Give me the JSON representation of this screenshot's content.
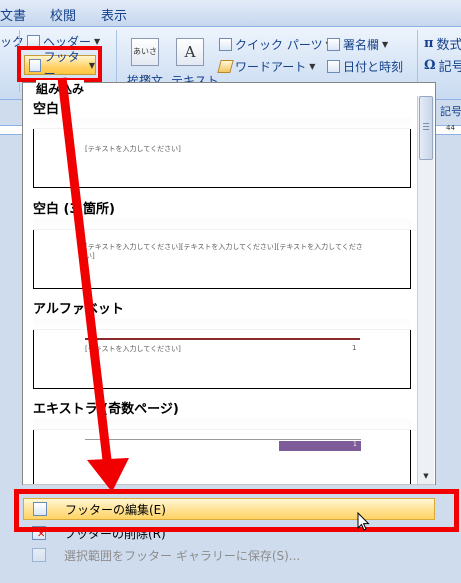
{
  "tabs": [
    {
      "label": "文書"
    },
    {
      "label": "校閲"
    },
    {
      "label": "表示"
    }
  ],
  "ribbon": {
    "left_partial": "ック",
    "header_label": "ヘッダー",
    "footer_label": "フッター",
    "textbox_label": "テキスト",
    "aisatsu_partial": "挨拶文",
    "aisatsu_icon_text": "あいさつ",
    "quick_parts_label": "クイック パーツ",
    "wordart_label": "ワードアート",
    "signature_label": "署名欄",
    "datetime_label": "日付と時刻",
    "equation_partial": "数式",
    "symbol_partial": "記号",
    "symbol_partial2": "記号",
    "ruler_right": "44"
  },
  "gallery": {
    "category_partial": "組み込み",
    "sections": [
      {
        "title": "空白",
        "placeholders": [
          "[テキストを入力してください]"
        ]
      },
      {
        "title": "空白 (3 箇所)",
        "placeholders": [
          "[テキストを入力してください][テキストを入力してください][テキストを入力してくださ",
          "い]"
        ]
      },
      {
        "title": "アルファベット",
        "placeholders": [
          "[テキストを入力してください]",
          "1"
        ]
      },
      {
        "title": "エキストラ (奇数ページ)",
        "placeholders": [
          "1"
        ]
      }
    ]
  },
  "menu": {
    "edit_footer": "フッターの編集(E)",
    "remove_footer": "フッターの削除(R)",
    "save_selection": "選択範囲をフッター ギャラリーに保存(S)..."
  },
  "colors": {
    "highlight_red": "#f00000",
    "alphabet_rule": "#8b2a2a",
    "extra_bar": "#7e5b99"
  }
}
